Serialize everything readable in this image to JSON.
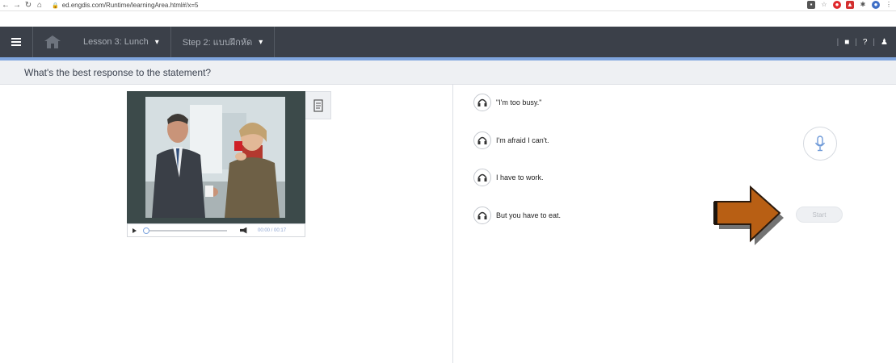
{
  "browser": {
    "url": "ed.engdis.com/Runtime/learningArea.html#/x=5"
  },
  "header": {
    "lesson_label": "Lesson 3: Lunch",
    "step_label": "Step 2: แบบฝึกหัด",
    "right_tools": [
      "|",
      "?",
      "|"
    ]
  },
  "instruction": {
    "text": "What's the best response to the statement?"
  },
  "player": {
    "time": "00:00 / 00:17",
    "progress": 0
  },
  "options": [
    {
      "label": "\"I'm too busy.\""
    },
    {
      "label": "I'm afraid I can't."
    },
    {
      "label": "I have to work."
    },
    {
      "label": "But you have to eat."
    }
  ],
  "recorder": {
    "start_label": "Start"
  },
  "colors": {
    "header_bg": "#3b4049",
    "accent": "#7fa5de",
    "arrow": "#b85f14"
  }
}
